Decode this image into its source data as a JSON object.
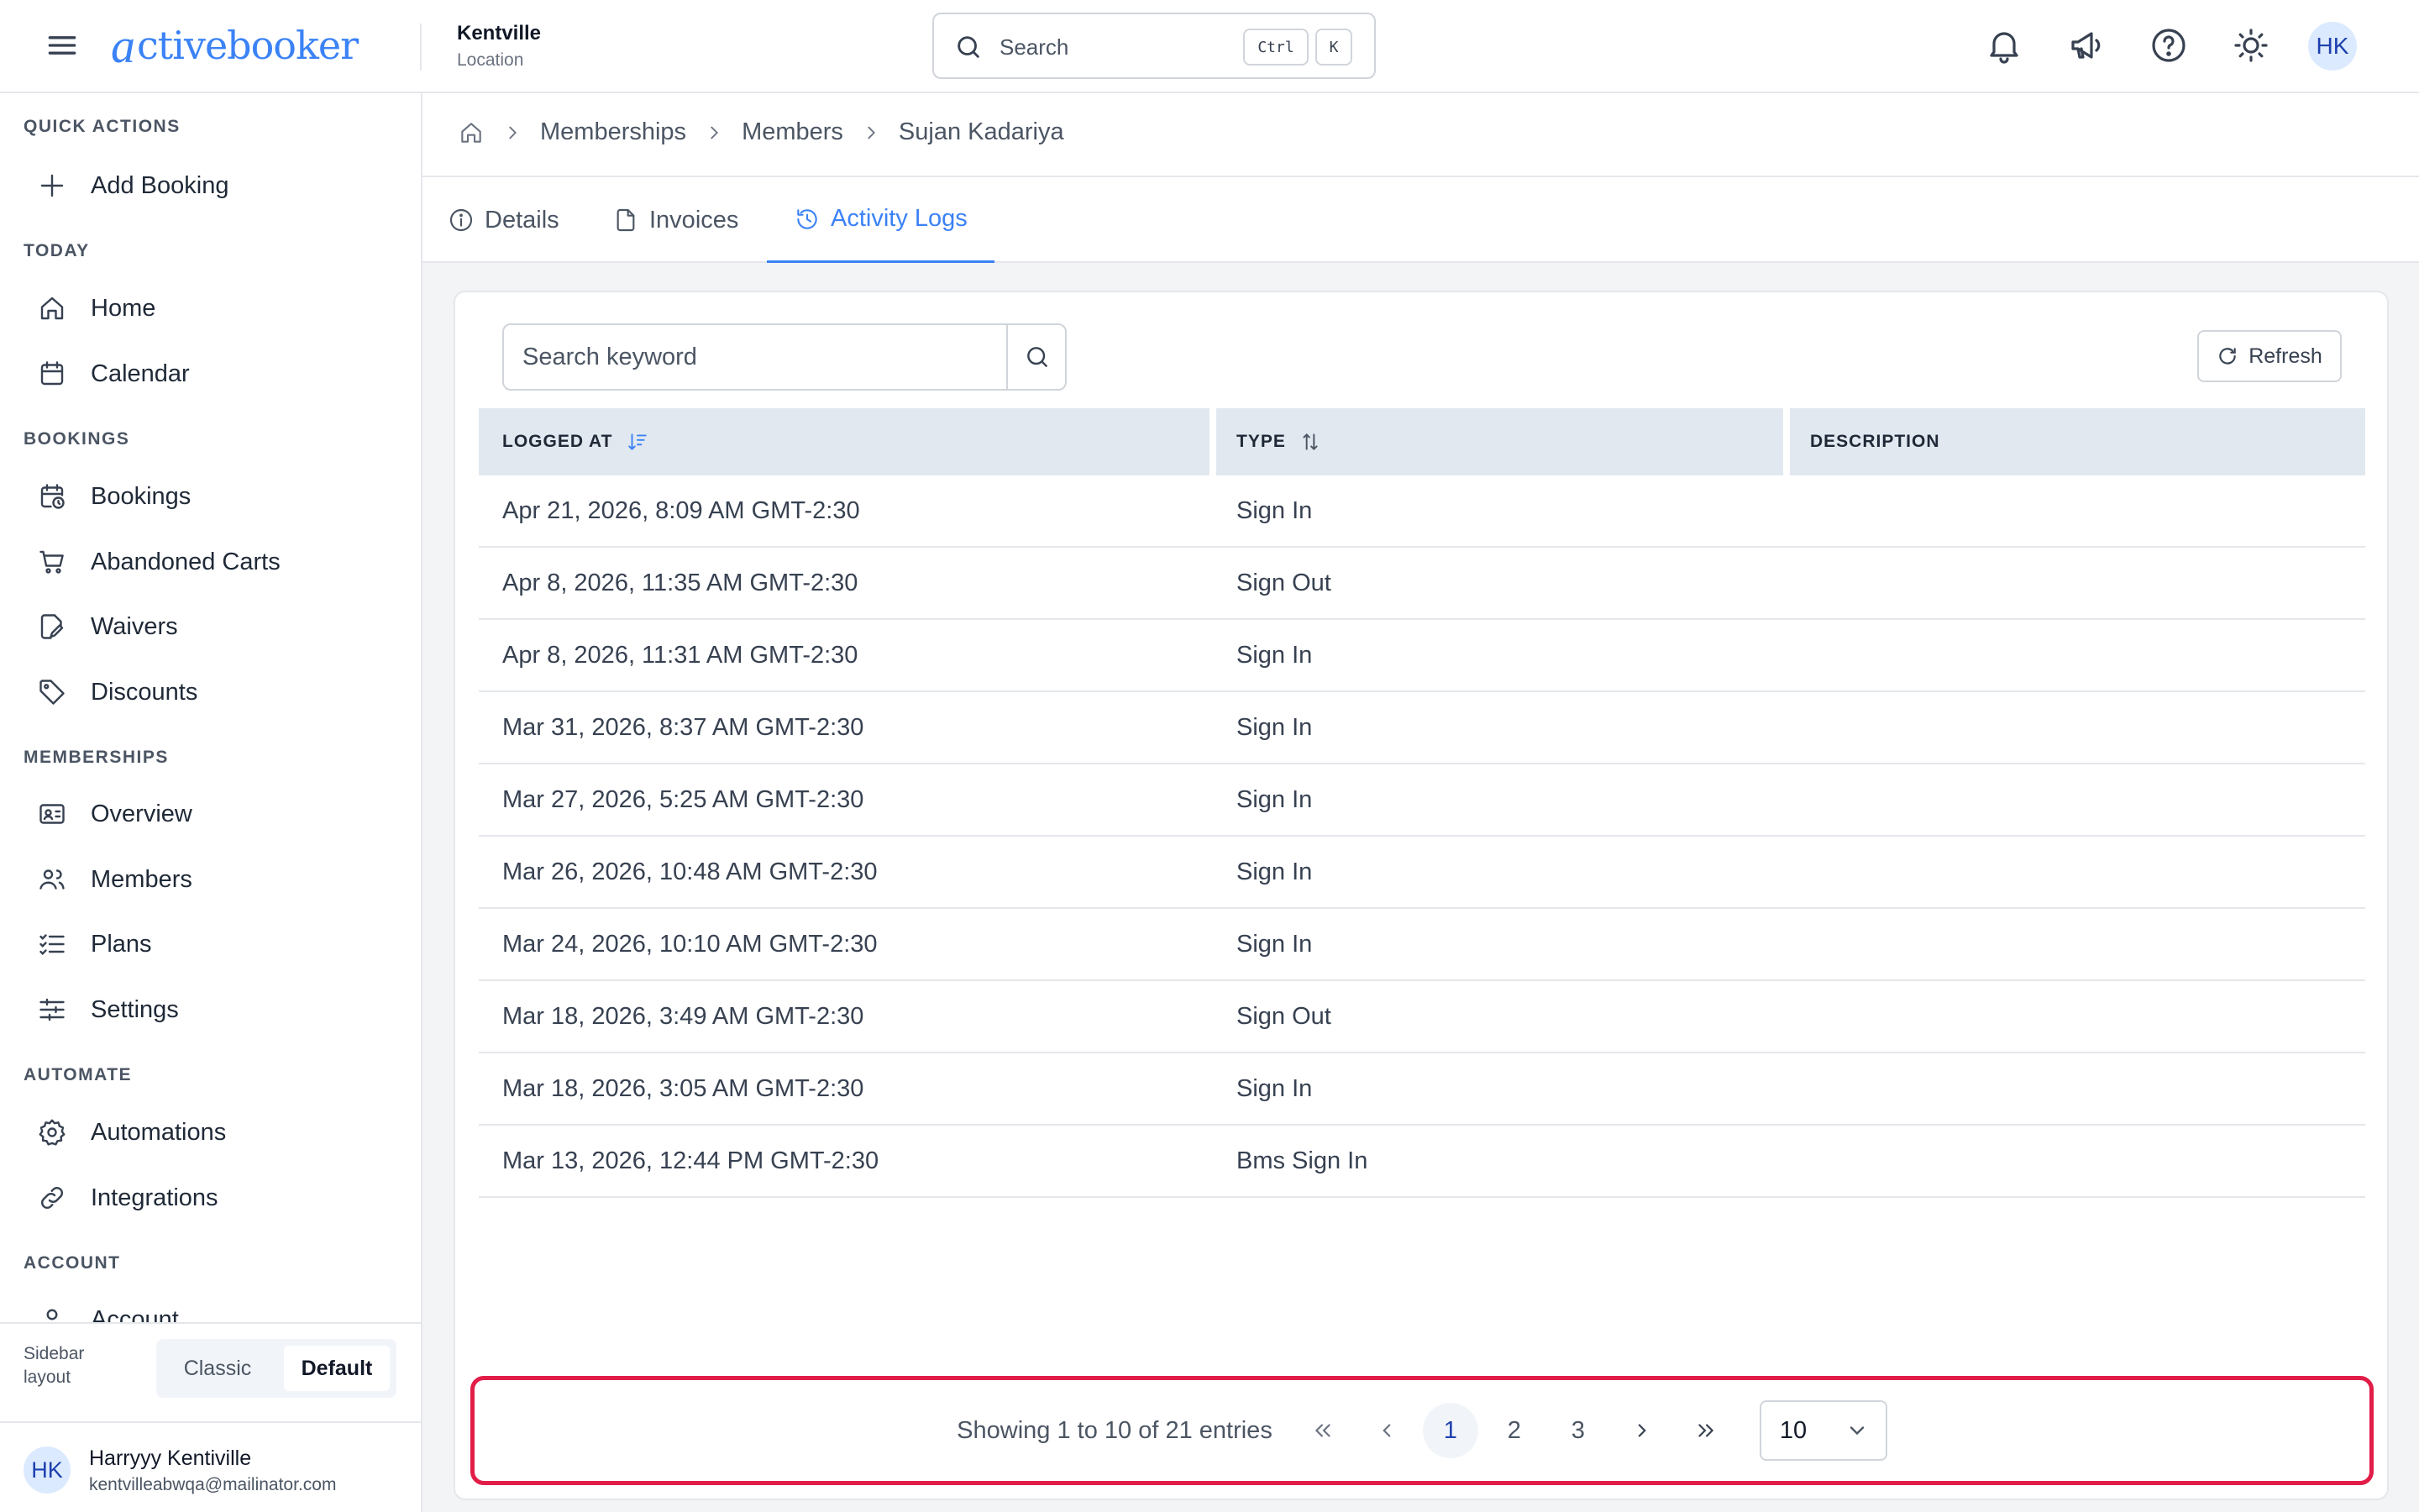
{
  "brand": {
    "logo_a": "a",
    "logo_text": "ctivebooker",
    "accent": "#3b82f6"
  },
  "location": {
    "name": "Kentville",
    "sub": "Location"
  },
  "search": {
    "placeholder": "Search",
    "kbd_ctrl": "Ctrl",
    "kbd_k": "K"
  },
  "header_icons": [
    "bell-icon",
    "megaphone-icon",
    "help-icon",
    "sun-icon"
  ],
  "user": {
    "initials": "HK",
    "name": "Harryyy Kentiville",
    "email": "kentvilleabwqa@mailinator.com"
  },
  "sidebar": {
    "sections": [
      {
        "title": "QUICK ACTIONS",
        "items": [
          {
            "label": "Add Booking",
            "icon": "plus-icon"
          }
        ]
      },
      {
        "title": "TODAY",
        "items": [
          {
            "label": "Home",
            "icon": "home-icon"
          },
          {
            "label": "Calendar",
            "icon": "calendar-icon"
          }
        ]
      },
      {
        "title": "BOOKINGS",
        "items": [
          {
            "label": "Bookings",
            "icon": "calendar-clock-icon"
          },
          {
            "label": "Abandoned Carts",
            "icon": "cart-icon"
          },
          {
            "label": "Waivers",
            "icon": "file-signature-icon"
          },
          {
            "label": "Discounts",
            "icon": "tag-icon"
          }
        ]
      },
      {
        "title": "MEMBERSHIPS",
        "items": [
          {
            "label": "Overview",
            "icon": "id-card-icon"
          },
          {
            "label": "Members",
            "icon": "users-icon"
          },
          {
            "label": "Plans",
            "icon": "list-checks-icon"
          },
          {
            "label": "Settings",
            "icon": "sliders-icon"
          }
        ]
      },
      {
        "title": "AUTOMATE",
        "items": [
          {
            "label": "Automations",
            "icon": "gear-icon"
          },
          {
            "label": "Integrations",
            "icon": "link-icon"
          }
        ]
      },
      {
        "title": "ACCOUNT",
        "items": [
          {
            "label": "Account",
            "icon": "user-icon"
          }
        ]
      }
    ],
    "layout_label": "Sidebar layout",
    "layout_options": [
      "Classic",
      "Default"
    ],
    "layout_selected": "Default"
  },
  "breadcrumb": [
    "Memberships",
    "Members",
    "Sujan Kadariya"
  ],
  "tabs": [
    {
      "label": "Details",
      "icon": "info-icon"
    },
    {
      "label": "Invoices",
      "icon": "file-icon"
    },
    {
      "label": "Activity Logs",
      "icon": "history-icon",
      "active": true
    }
  ],
  "activity": {
    "search_placeholder": "Search keyword",
    "refresh_label": "Refresh",
    "columns": [
      "LOGGED AT",
      "TYPE",
      "DESCRIPTION"
    ],
    "rows": [
      {
        "logged_at": "Apr 21, 2026, 8:09 AM GMT-2:30",
        "type": "Sign In",
        "description": ""
      },
      {
        "logged_at": "Apr 8, 2026, 11:35 AM GMT-2:30",
        "type": "Sign Out",
        "description": ""
      },
      {
        "logged_at": "Apr 8, 2026, 11:31 AM GMT-2:30",
        "type": "Sign In",
        "description": ""
      },
      {
        "logged_at": "Mar 31, 2026, 8:37 AM GMT-2:30",
        "type": "Sign In",
        "description": ""
      },
      {
        "logged_at": "Mar 27, 2026, 5:25 AM GMT-2:30",
        "type": "Sign In",
        "description": ""
      },
      {
        "logged_at": "Mar 26, 2026, 10:48 AM GMT-2:30",
        "type": "Sign In",
        "description": ""
      },
      {
        "logged_at": "Mar 24, 2026, 10:10 AM GMT-2:30",
        "type": "Sign In",
        "description": ""
      },
      {
        "logged_at": "Mar 18, 2026, 3:49 AM GMT-2:30",
        "type": "Sign Out",
        "description": ""
      },
      {
        "logged_at": "Mar 18, 2026, 3:05 AM GMT-2:30",
        "type": "Sign In",
        "description": ""
      },
      {
        "logged_at": "Mar 13, 2026, 12:44 PM GMT-2:30",
        "type": "Bms Sign In",
        "description": ""
      }
    ],
    "pagination": {
      "info": "Showing 1 to 10 of 21 entries",
      "pages": [
        "1",
        "2",
        "3"
      ],
      "current_page": "1",
      "rows_per_page": "10"
    }
  },
  "colors": {
    "highlight_frame": "#e11d48",
    "table_header_bg": "#e2e8f0"
  }
}
